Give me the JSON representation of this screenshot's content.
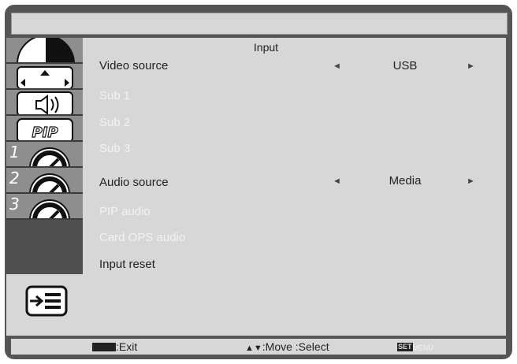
{
  "title_bar": "",
  "sidebar": {
    "tabs": [
      {
        "icon": "picture-icon",
        "number": ""
      },
      {
        "icon": "screen-position-icon",
        "number": ""
      },
      {
        "icon": "audio-icon",
        "number": ""
      },
      {
        "icon": "pip-icon",
        "label": "PIP",
        "number": ""
      },
      {
        "icon": "gauge-icon",
        "number": "1"
      },
      {
        "icon": "gauge-icon",
        "number": "2"
      },
      {
        "icon": "gauge-icon",
        "number": "3"
      },
      {
        "icon": "input-icon",
        "active": true
      }
    ]
  },
  "main": {
    "header": "Input",
    "rows": [
      {
        "label": "Video source",
        "value": "USB",
        "enabled": true,
        "has_arrows": true
      },
      {
        "label": "Sub 1",
        "enabled": false
      },
      {
        "label": "Sub 2",
        "enabled": false
      },
      {
        "label": "Sub 3",
        "enabled": false
      },
      {
        "label": "Audio source",
        "value": "Media",
        "enabled": true,
        "has_arrows": true
      },
      {
        "label": "PIP audio",
        "enabled": false
      },
      {
        "label": "Card OPS audio",
        "enabled": false
      },
      {
        "label": "Input reset",
        "enabled": true
      }
    ],
    "left_arrow": "◄",
    "right_arrow": "►"
  },
  "footer": {
    "exit": ":Exit",
    "move_arrows": "▲▼",
    "move_select": ":Move :Select",
    "set_key": "SET",
    "menu_key": "MENU"
  }
}
